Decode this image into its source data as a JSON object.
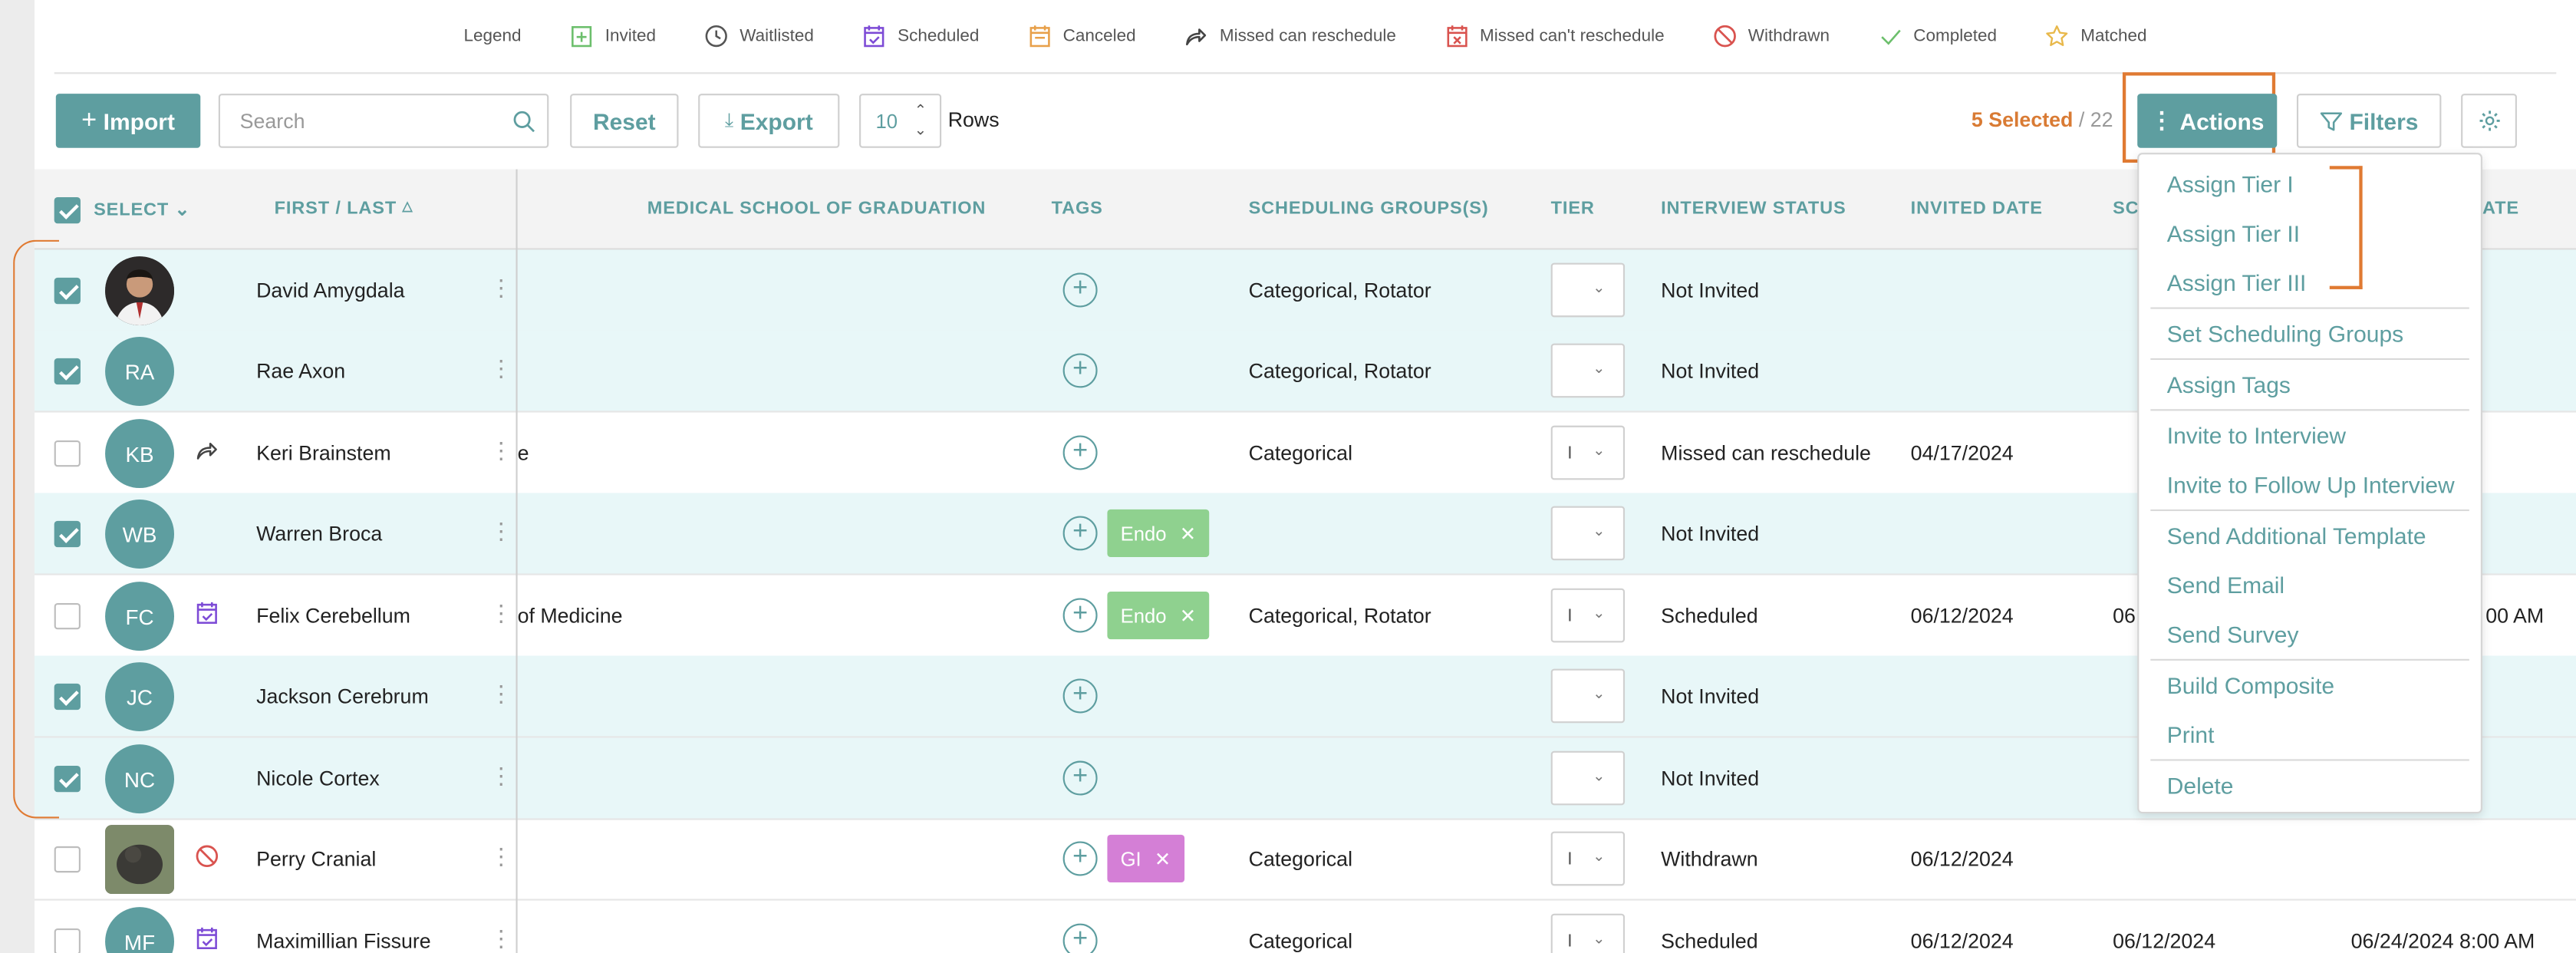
{
  "legend": {
    "title": "Legend",
    "items": [
      {
        "label": "Invited",
        "icon": "invited-icon"
      },
      {
        "label": "Waitlisted",
        "icon": "clock-icon"
      },
      {
        "label": "Scheduled",
        "icon": "calendar-check-icon"
      },
      {
        "label": "Canceled",
        "icon": "calendar-icon"
      },
      {
        "label": "Missed can reschedule",
        "icon": "share-arrow-icon"
      },
      {
        "label": "Missed can't reschedule",
        "icon": "calendar-x-icon"
      },
      {
        "label": "Withdrawn",
        "icon": "prohibited-icon"
      },
      {
        "label": "Completed",
        "icon": "check-icon"
      },
      {
        "label": "Matched",
        "icon": "star-icon"
      }
    ]
  },
  "toolbar": {
    "import_label": "Import",
    "search_placeholder": "Search",
    "reset_label": "Reset",
    "export_label": "Export",
    "rows_value": "10",
    "rows_label": "Rows",
    "selected_count": "5 Selected",
    "total_count": "/ 22",
    "actions_label": "Actions",
    "filters_label": "Filters"
  },
  "columns": {
    "select": "SELECT",
    "name": "FIRST / LAST",
    "school": "MEDICAL SCHOOL OF GRADUATION",
    "tags": "TAGS",
    "groups": "SCHEDULING GROUPS(S)",
    "tier": "TIER",
    "status": "INTERVIEW STATUS",
    "invited": "INVITED DATE",
    "sc": "SC",
    "ate": "ATE"
  },
  "rows": [
    {
      "name": "David Amygdala",
      "initials": "",
      "selected": true,
      "school": "",
      "tags": [],
      "groups": "Categorical, Rotator",
      "tier": "",
      "status": "Not Invited",
      "invited": "",
      "sched": "",
      "end": ""
    },
    {
      "name": "Rae Axon",
      "initials": "RA",
      "selected": true,
      "school": "",
      "tags": [],
      "groups": "Categorical, Rotator",
      "tier": "",
      "status": "Not Invited",
      "invited": "",
      "sched": "",
      "end": ""
    },
    {
      "name": "Keri Brainstem",
      "initials": "KB",
      "selected": false,
      "school": "e",
      "tags": [],
      "groups": "Categorical",
      "tier": "I",
      "status": "Missed can reschedule",
      "invited": "04/17/2024",
      "sched": "",
      "end": ""
    },
    {
      "name": "Warren Broca",
      "initials": "WB",
      "selected": true,
      "school": "",
      "tags": [
        "Endo"
      ],
      "groups": "",
      "tier": "",
      "status": "Not Invited",
      "invited": "",
      "sched": "",
      "end": ""
    },
    {
      "name": "Felix Cerebellum",
      "initials": "FC",
      "selected": false,
      "school": "of Medicine",
      "tags": [
        "Endo"
      ],
      "groups": "Categorical, Rotator",
      "tier": "I",
      "status": "Scheduled",
      "invited": "06/12/2024",
      "sched": "06",
      "end": "00 AM"
    },
    {
      "name": "Jackson Cerebrum",
      "initials": "JC",
      "selected": true,
      "school": "",
      "tags": [],
      "groups": "",
      "tier": "",
      "status": "Not Invited",
      "invited": "",
      "sched": "",
      "end": ""
    },
    {
      "name": "Nicole Cortex",
      "initials": "NC",
      "selected": true,
      "school": "",
      "tags": [],
      "groups": "",
      "tier": "",
      "status": "Not Invited",
      "invited": "",
      "sched": "",
      "end": ""
    },
    {
      "name": "Perry Cranial",
      "initials": "",
      "selected": false,
      "school": "",
      "tags": [
        "GI"
      ],
      "groups": "Categorical",
      "tier": "I",
      "status": "Withdrawn",
      "invited": "06/12/2024",
      "sched": "",
      "end": ""
    },
    {
      "name": "Maximillian Fissure",
      "initials": "MF",
      "selected": false,
      "school": "",
      "tags": [],
      "groups": "Categorical",
      "tier": "I",
      "status": "Scheduled",
      "invited": "06/12/2024",
      "sched": "06/12/2024",
      "end": "06/24/2024 8:00 AM"
    }
  ],
  "menu": [
    "Assign Tier I",
    "Assign Tier II",
    "Assign Tier III",
    "Set Scheduling Groups",
    "Assign Tags",
    "Invite to Interview",
    "Invite to Follow Up Interview",
    "Send Additional Template",
    "Send Email",
    "Send Survey",
    "Build Composite",
    "Print",
    "Delete"
  ],
  "colors": {
    "accent": "#5e9ea0",
    "highlight": "#e07a32",
    "tag_endo": "#8fd18f",
    "tag_gi": "#d47fd6"
  }
}
